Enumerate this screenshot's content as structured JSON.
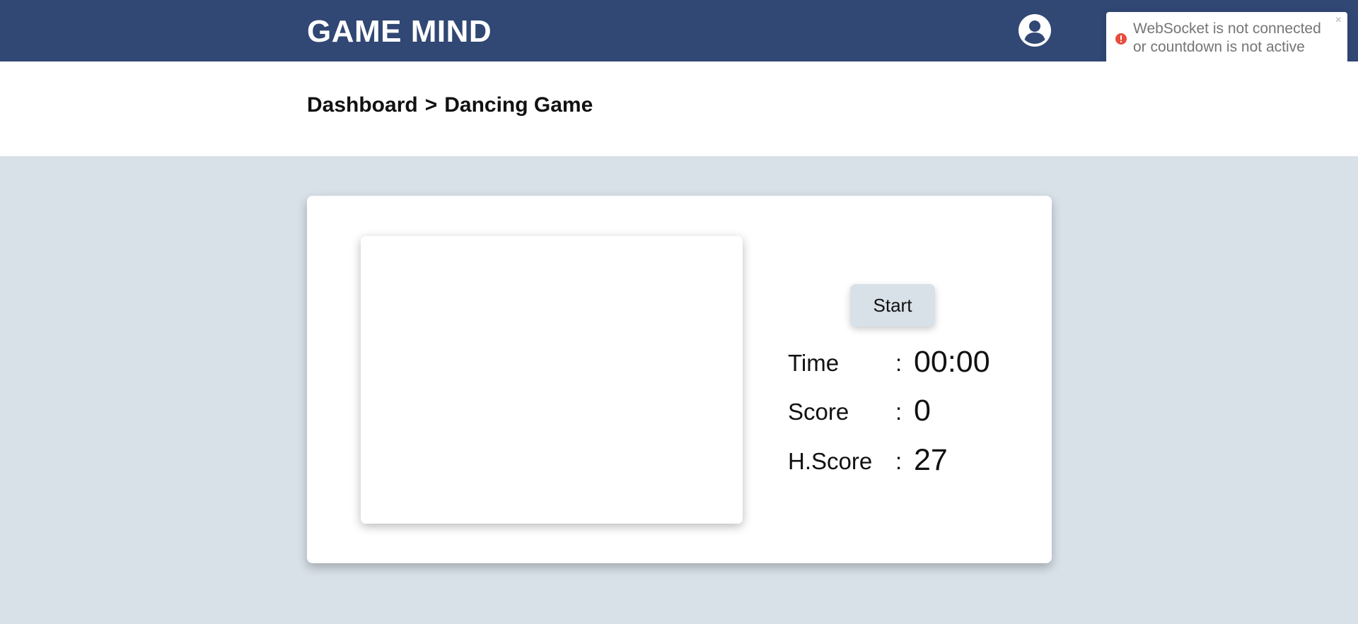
{
  "header": {
    "brand": "GAME MIND",
    "user_icon": "user-circle-icon"
  },
  "toast": {
    "message": "WebSocket is not connected or countdown is not active",
    "close_label": "×",
    "icon": "error-icon",
    "progress": 0.53,
    "color": "#e74c3c"
  },
  "breadcrumb": {
    "parent": "Dashboard",
    "separator": ">",
    "current": "Dancing Game"
  },
  "game": {
    "start_label": "Start",
    "colon": ":",
    "stats": [
      {
        "label": "Time",
        "value": "00:00"
      },
      {
        "label": "Score",
        "value": "0"
      },
      {
        "label": "H.Score",
        "value": "27"
      }
    ]
  },
  "colors": {
    "header_bg": "#314774",
    "page_bg": "#d8e0e8",
    "button_bg": "#d8e0e8"
  }
}
